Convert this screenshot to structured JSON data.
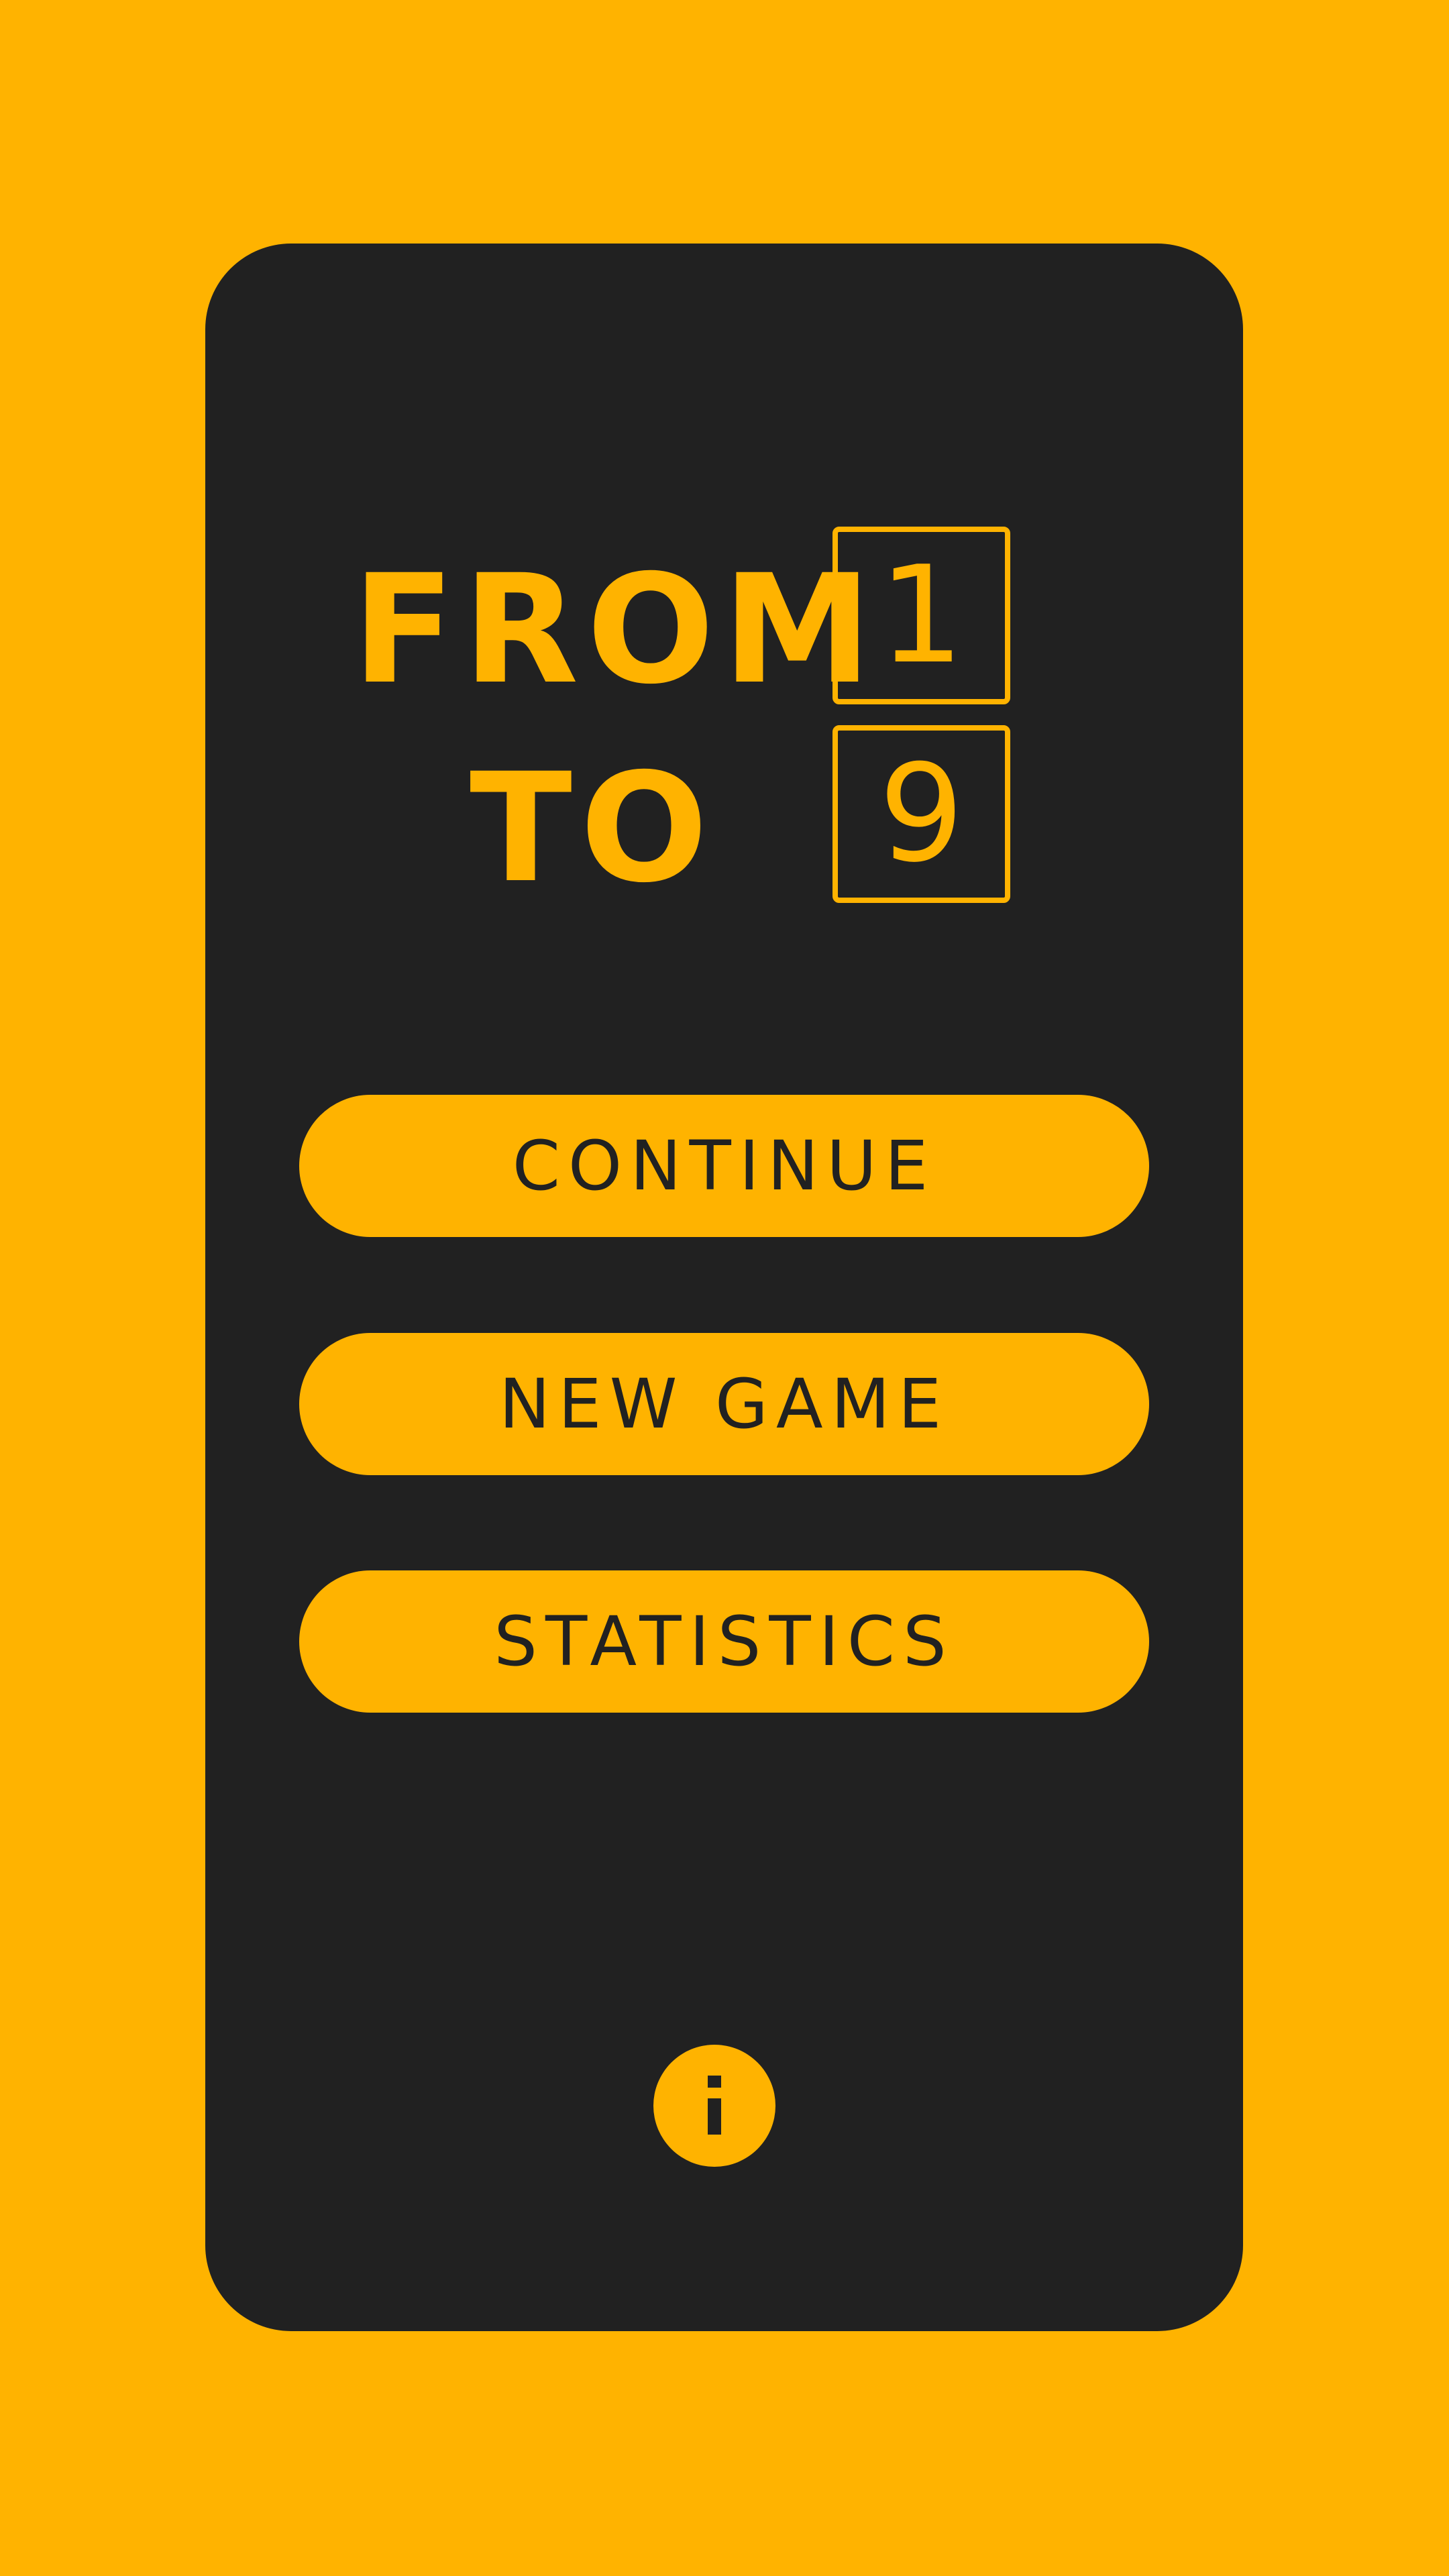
{
  "theme": {
    "background": "#FFB300",
    "card": "#212121",
    "accent": "#FFB300",
    "button_text": "#212121"
  },
  "title": {
    "from": "FROM",
    "to": "TO",
    "digit_first": "1",
    "digit_last": "9"
  },
  "menu": {
    "continue_label": "CONTINUE",
    "new_game_label": "NEW GAME",
    "statistics_label": "STATISTICS"
  },
  "info": {
    "icon": "info-icon"
  }
}
